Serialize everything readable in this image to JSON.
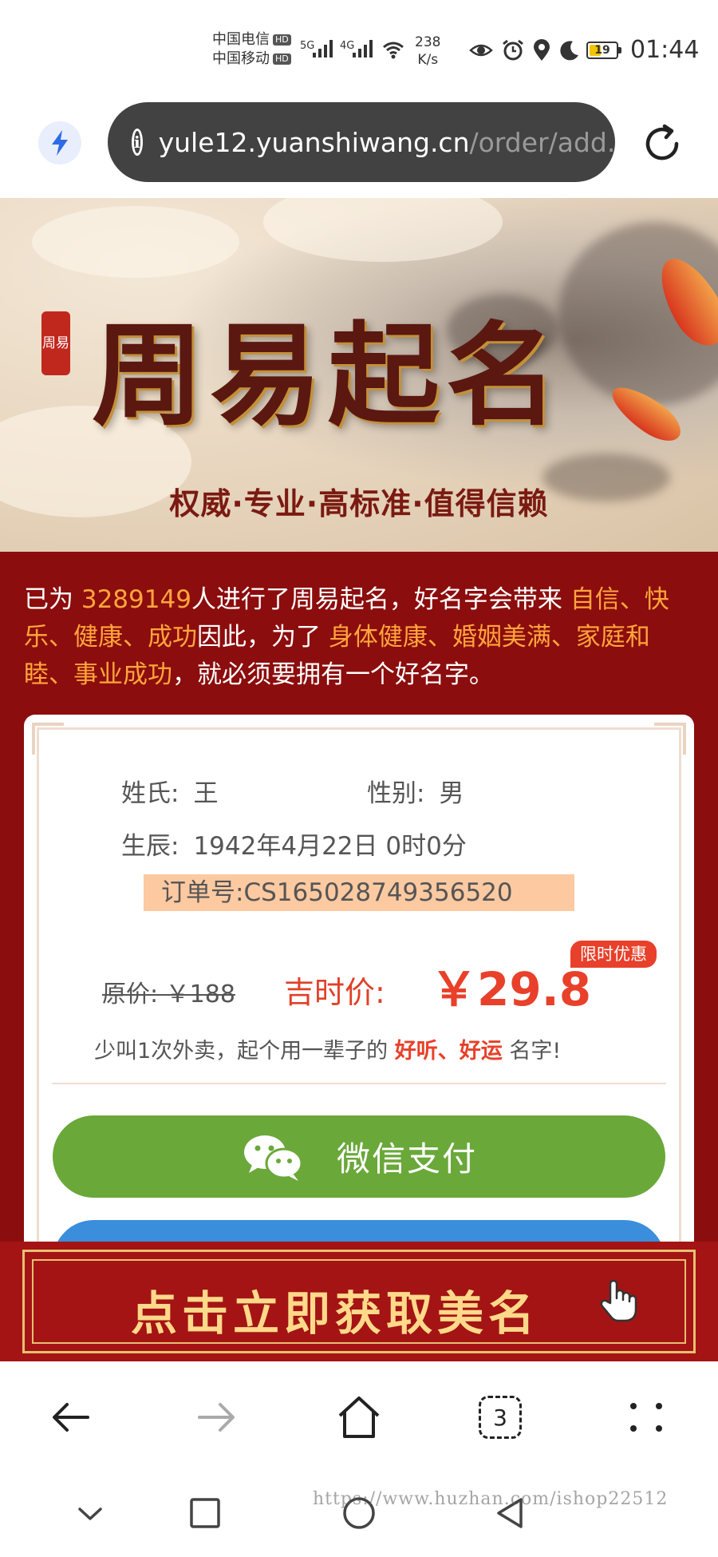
{
  "status_bar": {
    "carrier1": "中国电信",
    "carrier2": "中国移动",
    "hd": "HD",
    "net1": "5G",
    "net2": "4G",
    "speed_value": "238",
    "speed_unit": "K/s",
    "battery": "19",
    "time": "01:44"
  },
  "browser": {
    "url_host": "yule12.yuanshiwang.cn",
    "url_path": "/order/add.",
    "tab_count": "3"
  },
  "banner": {
    "seal": "周易",
    "title": "周易起名",
    "subtitle": "权威·专业·高标准·值得信赖"
  },
  "intro": {
    "p1": "已为 ",
    "count": "3289149",
    "p2": "人进行了周易起名，好名字会带来 ",
    "benefits": "自信、快乐、健康、成功",
    "p3": "因此，为了 ",
    "goals": "身体健康、婚姻美满、家庭和睦、事业成功",
    "p4": "，就必须要拥有一个好名字。"
  },
  "order": {
    "surname_label": "姓氏:",
    "surname": "王",
    "gender_label": "性别:",
    "gender": "男",
    "birth_label": "生辰:",
    "birth": "1942年4月22日 0时0分",
    "order_label": "订单号:",
    "order_no": "CS165028749356520",
    "original_price": "原价: ￥188",
    "jishi_label": "吉时价:",
    "price": "￥29.8",
    "badge": "限时优惠",
    "slogan_p1": "少叫1次外卖，起个用一辈子的 ",
    "slogan_hl": "好听、好运",
    "slogan_p2": " 名字!"
  },
  "buttons": {
    "wechat_pay": "微信支付",
    "cta": "点击立即获取美名"
  },
  "watermark": "https://www.huzhan.com/ishop22512",
  "colors": {
    "red_bg": "#8c0d0d",
    "accent_orange": "#ffa53c",
    "price_red": "#e8402a",
    "wechat_green": "#6aa83a",
    "alipay_blue": "#3a8edc"
  }
}
